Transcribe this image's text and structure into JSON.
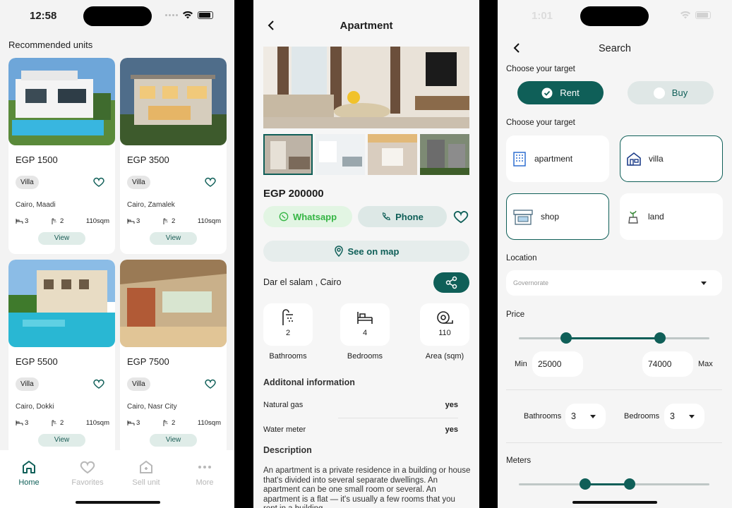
{
  "home": {
    "status_time": "12:58",
    "section_title": "Recommended units",
    "cards": [
      {
        "price": "EGP 1500",
        "type": "Villa",
        "location": "Cairo, Maadi",
        "beds": "3",
        "baths": "2",
        "area": "110sqm",
        "view": "View"
      },
      {
        "price": "EGP 3500",
        "type": "Villa",
        "location": "Cairo, Zamalek",
        "beds": "3",
        "baths": "2",
        "area": "110sqm",
        "view": "View"
      },
      {
        "price": "EGP 5500",
        "type": "Villa",
        "location": "Cairo, Dokki",
        "beds": "3",
        "baths": "2",
        "area": "110sqm",
        "view": "View"
      },
      {
        "price": "EGP 7500",
        "type": "Villa",
        "location": "Cairo, Nasr City",
        "beds": "3",
        "baths": "2",
        "area": "110sqm",
        "view": "View"
      }
    ],
    "tabs": [
      {
        "label": "Home",
        "icon": "home-icon",
        "active": true
      },
      {
        "label": "Favorites",
        "icon": "heart-icon",
        "active": false
      },
      {
        "label": "Sell unit",
        "icon": "sell-unit-icon",
        "active": false
      },
      {
        "label": "More",
        "icon": "more-icon",
        "active": false
      }
    ]
  },
  "detail": {
    "title": "Apartment",
    "price": "EGP 200000",
    "whatsapp": "Whatsapp",
    "phone": "Phone",
    "see_on_map": "See on map",
    "address": "Dar el salam , Cairo",
    "features": [
      {
        "value": "2",
        "label": "Bathrooms",
        "icon": "shower-icon"
      },
      {
        "value": "4",
        "label": "Bedrooms",
        "icon": "bed-icon"
      },
      {
        "value": "110",
        "label": "Area (sqm)",
        "icon": "area-icon"
      }
    ],
    "additional_title": "Additonal information",
    "info": [
      {
        "key": "Natural gas",
        "value": "yes"
      },
      {
        "key": "Water meter",
        "value": "yes"
      }
    ],
    "description_title": "Description",
    "description": "An apartment is a private residence in a building or house that's divided into several separate dwellings. An apartment can be one small room or several. An apartment is a flat — it's usually a few rooms that you rent in a building."
  },
  "search": {
    "status_time": "1:01",
    "title": "Search",
    "target_label": "Choose your target",
    "rent": "Rent",
    "buy": "Buy",
    "rent_selected": true,
    "type_label": "Choose your target",
    "types": [
      {
        "label": "apartment",
        "icon": "building-icon",
        "selected": false
      },
      {
        "label": "villa",
        "icon": "villa-icon",
        "selected": true
      },
      {
        "label": "shop",
        "icon": "shop-icon",
        "selected": true
      },
      {
        "label": "land",
        "icon": "land-icon",
        "selected": false
      }
    ],
    "location_label": "Location",
    "governorate_placeholder": "Governorate",
    "price_label": "Price",
    "min_label": "Min",
    "max_label": "Max",
    "min_value": "25000",
    "max_value": "74000",
    "bathrooms_label": "Bathrooms",
    "bathrooms_value": "3",
    "bedrooms_label": "Bedrooms",
    "bedrooms_value": "3",
    "meters_label": "Meters",
    "accent": "#0f5f58"
  }
}
